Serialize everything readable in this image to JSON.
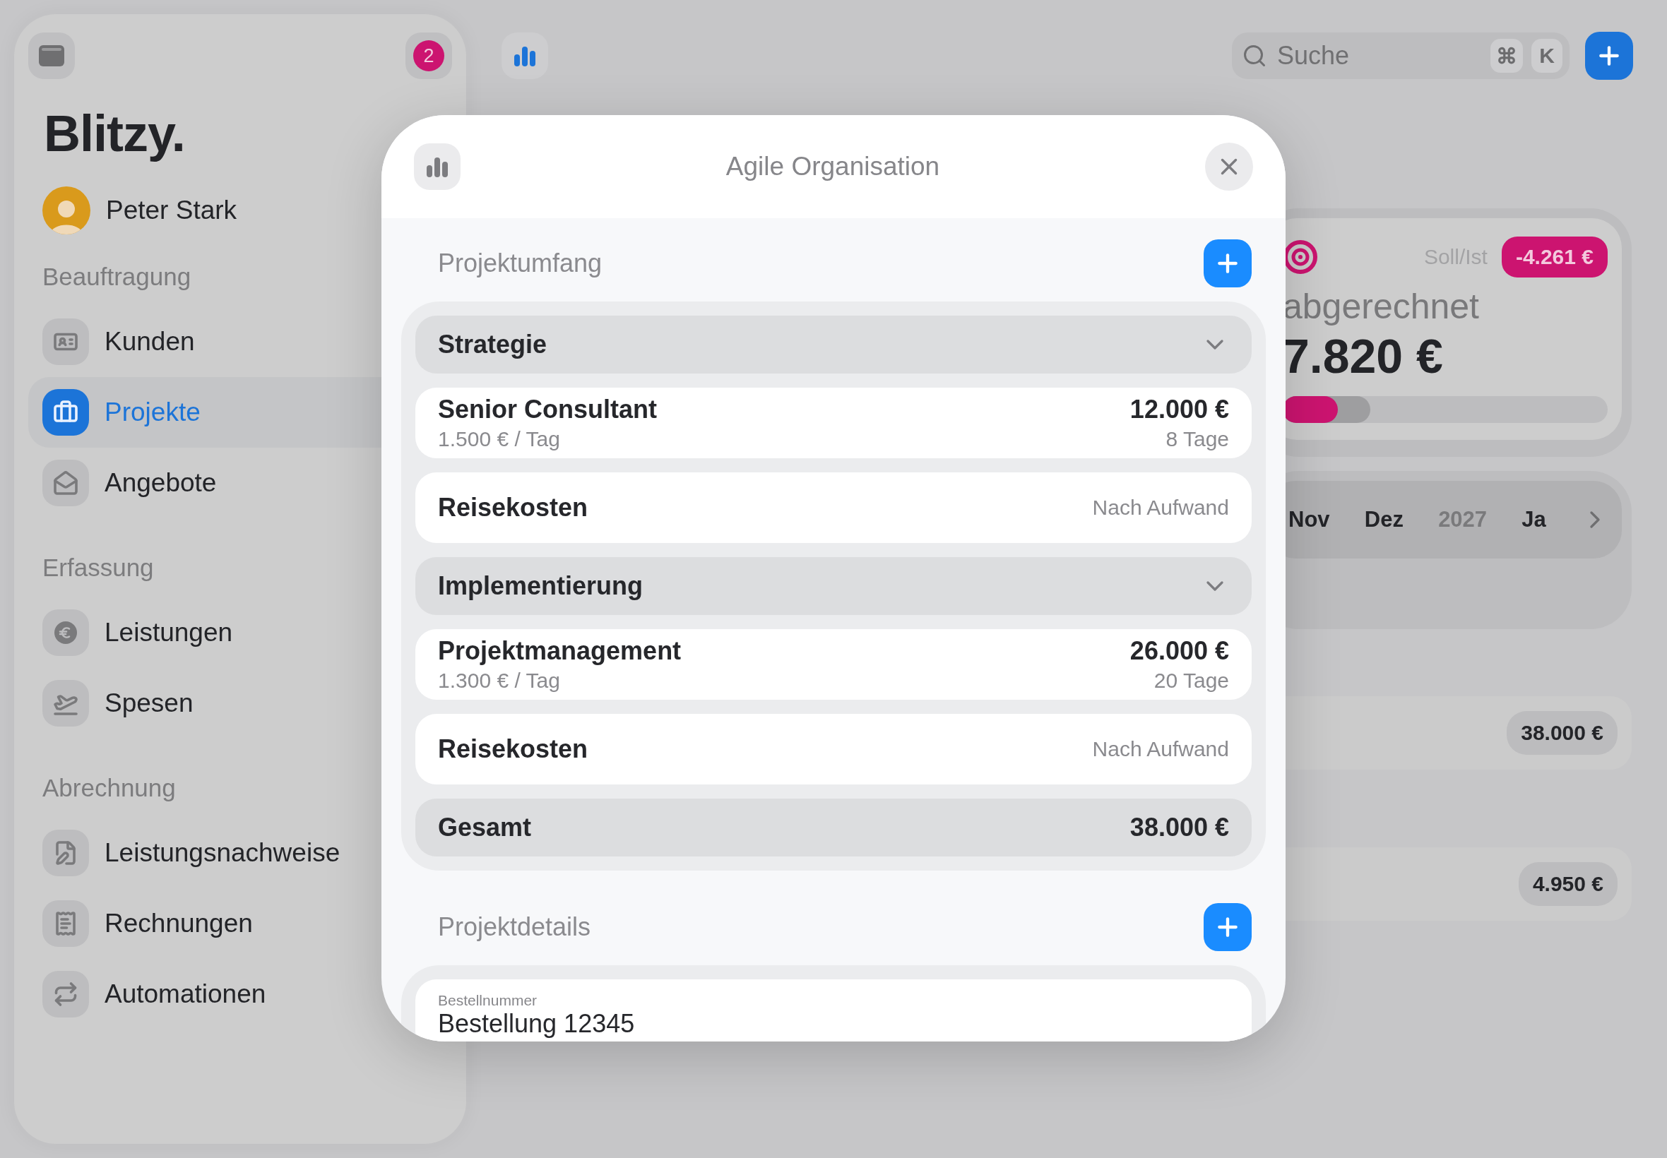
{
  "sidebar": {
    "badge": "2",
    "logo": "Blitzy.",
    "user": {
      "name": "Peter Stark"
    },
    "sections": [
      {
        "title": "Beauftragung",
        "items": [
          {
            "label": "Kunden",
            "selected": false
          },
          {
            "label": "Projekte",
            "selected": true
          },
          {
            "label": "Angebote",
            "selected": false
          }
        ]
      },
      {
        "title": "Erfassung",
        "items": [
          {
            "label": "Leistungen",
            "selected": false
          },
          {
            "label": "Spesen",
            "selected": false
          }
        ]
      },
      {
        "title": "Abrechnung",
        "items": [
          {
            "label": "Leistungsnachweise",
            "selected": false
          },
          {
            "label": "Rechnungen",
            "selected": false
          },
          {
            "label": "Automationen",
            "selected": false
          }
        ]
      }
    ]
  },
  "toolbar": {
    "search": {
      "placeholder": "Suche",
      "shortcut": [
        "⌘",
        "K"
      ]
    }
  },
  "summary": {
    "label": "Soll/Ist",
    "difference": "-4.261 €",
    "caption": "abgerechnet",
    "amount": "7.820 €",
    "progress": [
      {
        "kind": "actual",
        "level": 0.17
      },
      {
        "kind": "planned",
        "level": 0.27
      }
    ]
  },
  "timeline": {
    "periods": [
      {
        "label": "Nov",
        "kind": "month"
      },
      {
        "label": "Dez",
        "kind": "month"
      },
      {
        "label": "2027",
        "kind": "year"
      },
      {
        "label": "Ja",
        "kind": "month"
      }
    ]
  },
  "rows": [
    {
      "amount": "38.000 €"
    },
    {
      "amount": "4.950 €"
    }
  ],
  "modal": {
    "title": "Agile Organisation",
    "scope": {
      "title": "Projektumfang",
      "items": [
        {
          "kind": "group",
          "label": "Strategie",
          "expanded": true
        },
        {
          "kind": "position",
          "label": "Senior Consultant",
          "rate": "1.500 € / Tag",
          "amount": "12.000 €",
          "quantity": "8 Tage"
        },
        {
          "kind": "flat",
          "label": "Reisekosten",
          "note": "Nach Aufwand"
        },
        {
          "kind": "group",
          "label": "Implementierung",
          "expanded": true
        },
        {
          "kind": "position",
          "label": "Projektmanagement",
          "rate": "1.300 € / Tag",
          "amount": "26.000 €",
          "quantity": "20 Tage"
        },
        {
          "kind": "flat",
          "label": "Reisekosten",
          "note": "Nach Aufwand"
        },
        {
          "kind": "total",
          "label": "Gesamt",
          "amount": "38.000 €"
        }
      ]
    },
    "details": {
      "title": "Projektdetails",
      "fields": [
        {
          "label": "Bestellnummer",
          "value": "Bestellung 12345"
        }
      ]
    }
  }
}
